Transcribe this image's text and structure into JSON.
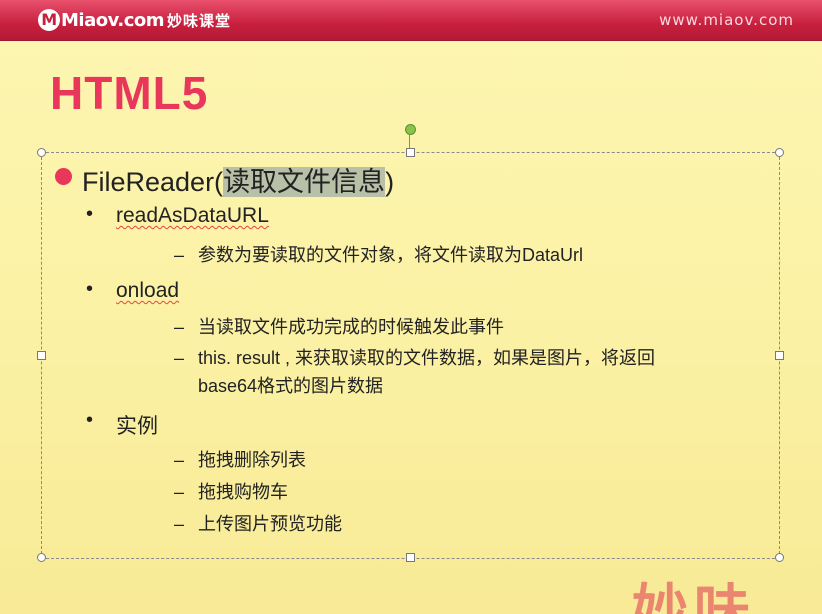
{
  "header": {
    "logo_text": "Miaov.com",
    "logo_cn": "妙味课堂",
    "url": "www.miaov.com"
  },
  "slide": {
    "title": "HTML5",
    "bullet_main": {
      "prefix": "FileReader(",
      "highlight": "读取文件信息",
      "suffix": ")"
    },
    "items": [
      {
        "label": "readAsDataURL",
        "subs": [
          "参数为要读取的文件对象，将文件读取为DataUrl"
        ]
      },
      {
        "label": "onload",
        "subs": [
          "当读取文件成功完成的时候触发此事件",
          "this. result , 来获取读取的文件数据，如果是图片，将返回",
          "base64格式的图片数据"
        ]
      },
      {
        "label": "实例",
        "subs": [
          "拖拽删除列表",
          "拖拽购物车",
          "上传图片预览功能"
        ]
      }
    ]
  },
  "watermark": "妙味",
  "colors": {
    "accent": "#e8375a",
    "banner": "#c8203f",
    "background": "#fbf1a4"
  }
}
